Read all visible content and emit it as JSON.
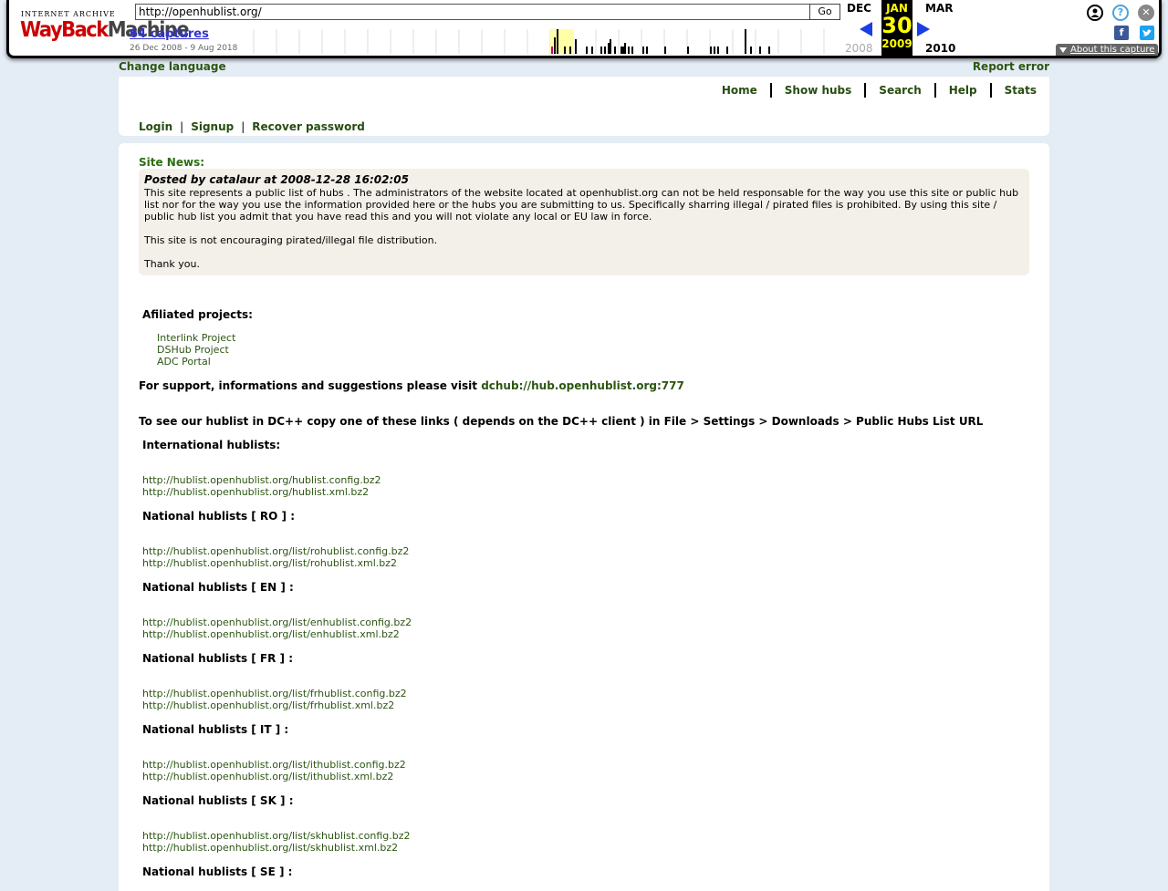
{
  "wayback": {
    "logo_top": "INTERNET ARCHIVE",
    "logo_way": "WayBack",
    "logo_machine": "Machine",
    "url": "http://openhublist.org/",
    "go_label": "Go",
    "captures_label": "64 captures",
    "range_label": "26 Dec 2008 - 9 Aug 2018",
    "prev_month": "DEC",
    "cur_month": "JAN",
    "next_month": "MAR",
    "cur_day": "30",
    "prev_year": "2008",
    "cur_year": "2009",
    "next_year": "2010",
    "about_label": "About this capture",
    "icons": [
      "user-icon",
      "help-icon",
      "close-icon",
      "facebook-icon",
      "twitter-icon"
    ]
  },
  "site": {
    "change_language": "Change language",
    "report_error": "Report error",
    "nav": [
      "Home",
      "Show hubs",
      "Search",
      "Help",
      "Stats"
    ],
    "auth": [
      "Login",
      "Signup",
      "Recover password"
    ],
    "auth_sep": "|",
    "site_news_label": "Site News:",
    "news": {
      "posted": "Posted by catalaur at 2008-12-28 16:02:05",
      "p1": "This site represents a public list of hubs . The administrators of the website located at openhublist.org can not be held responsable for the way you use this site or public hub list nor for the way you use the information provided here or the hubs you are submitting to us. Specifically sharring illegal / pirated files is prohibited. By using this site / public hub list you admit that you have read this and you will not violate any local or EU law in force.",
      "p2": "This site is not encouraging pirated/illegal file distribution.",
      "p3": "Thank you."
    },
    "affiliated_label": "Afiliated projects:",
    "affiliated": [
      "Interlink Project",
      "DSHub Project",
      "ADC Portal"
    ],
    "support_text": "For support, informations and suggestions please visit",
    "support_link": "dchub://hub.openhublist.org:777",
    "instructions": "To see our hublist in DC++ copy one of these links ( depends on the DC++ client ) in File > Settings > Downloads > Public Hubs List URL",
    "hublists": [
      {
        "label": "International hublists:",
        "links": [
          "http://hublist.openhublist.org/hublist.config.bz2",
          "http://hublist.openhublist.org/hublist.xml.bz2"
        ]
      },
      {
        "label": "National hublists [ RO ] :",
        "links": [
          "http://hublist.openhublist.org/list/rohublist.config.bz2",
          "http://hublist.openhublist.org/list/rohublist.xml.bz2"
        ]
      },
      {
        "label": "National hublists [ EN ] :",
        "links": [
          "http://hublist.openhublist.org/list/enhublist.config.bz2",
          "http://hublist.openhublist.org/list/enhublist.xml.bz2"
        ]
      },
      {
        "label": "National hublists [ FR ] :",
        "links": [
          "http://hublist.openhublist.org/list/frhublist.config.bz2",
          "http://hublist.openhublist.org/list/frhublist.xml.bz2"
        ]
      },
      {
        "label": "National hublists [ IT ] :",
        "links": [
          "http://hublist.openhublist.org/list/ithublist.config.bz2",
          "http://hublist.openhublist.org/list/ithublist.xml.bz2"
        ]
      },
      {
        "label": "National hublists [ SK ] :",
        "links": [
          "http://hublist.openhublist.org/list/skhublist.config.bz2",
          "http://hublist.openhublist.org/list/skhublist.xml.bz2"
        ]
      },
      {
        "label": "National hublists [ SE ] :",
        "links": []
      }
    ],
    "colors": {
      "link": "#2c5612",
      "news_bg": "#f3f0e9",
      "page_bg": "#e4ecf5",
      "site_news": "#2b6e0f"
    }
  }
}
